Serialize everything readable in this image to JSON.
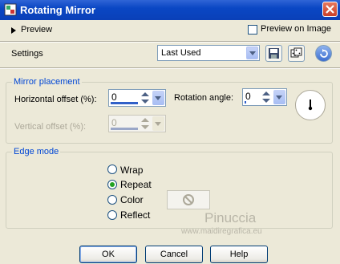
{
  "window": {
    "title": "Rotating Mirror"
  },
  "preview": {
    "label": "Preview",
    "checkbox_label": "Preview on Image",
    "checked": false
  },
  "settings": {
    "label": "Settings",
    "value": "Last Used"
  },
  "mirror": {
    "group_title": "Mirror placement",
    "horizontal_label": "Horizontal offset (%):",
    "horizontal_value": "0",
    "rotation_label": "Rotation angle:",
    "rotation_value": "0",
    "vertical_label": "Vertical offset (%):",
    "vertical_value": "0"
  },
  "edge": {
    "group_title": "Edge mode",
    "options": [
      {
        "label": "Wrap",
        "selected": false
      },
      {
        "label": "Repeat",
        "selected": true
      },
      {
        "label": "Color",
        "selected": false
      },
      {
        "label": "Reflect",
        "selected": false
      }
    ]
  },
  "buttons": {
    "ok": "OK",
    "cancel": "Cancel",
    "help": "Help"
  },
  "watermark": {
    "name": "Pinuccia",
    "url": "www.maidiregrafica.eu"
  },
  "icons": [
    "app-icon",
    "close-icon",
    "triangle-right-icon",
    "save-icon",
    "dice-icon",
    "reset-icon",
    "dial-icon",
    "no-color-icon"
  ]
}
